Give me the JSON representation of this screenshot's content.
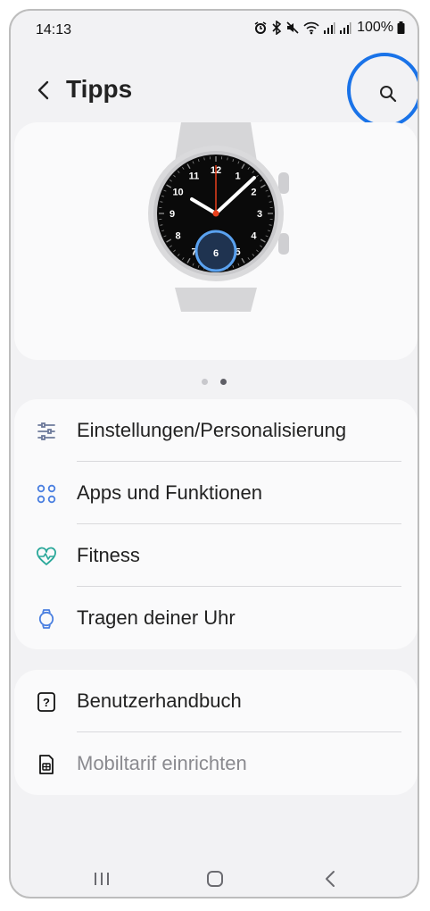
{
  "status_bar": {
    "time": "14:13",
    "battery": "100%",
    "icons": [
      "alarm-icon",
      "bluetooth-icon",
      "mute-icon",
      "wifi-icon",
      "signal-icon",
      "signal-icon",
      "battery-icon"
    ]
  },
  "header": {
    "title": "Tipps",
    "back_icon": "chevron-left-icon",
    "search_icon": "search-icon",
    "highlight_color": "#1a73e8"
  },
  "hero": {
    "image": "galaxy-watch-illustration",
    "watch_numbers": [
      "12",
      "1",
      "2",
      "3",
      "4",
      "5",
      "6",
      "7",
      "8",
      "9",
      "10",
      "11"
    ],
    "highlight_color": "#5aa2f0",
    "second_hand_color": "#e8401c"
  },
  "pager": {
    "count": 2,
    "active": 2
  },
  "menu": {
    "items": [
      {
        "label": "Einstellungen/Personalisierung",
        "icon": "sliders-icon",
        "icon_color": "#6d7a9b"
      },
      {
        "label": "Apps und Funktionen",
        "icon": "apps-grid-icon",
        "icon_color": "#4a7fe0"
      },
      {
        "label": "Fitness",
        "icon": "heart-pulse-icon",
        "icon_color": "#2aa89a"
      },
      {
        "label": "Tragen deiner Uhr",
        "icon": "watch-icon",
        "icon_color": "#4a7fe0"
      }
    ]
  },
  "secondary": {
    "items": [
      {
        "label": "Benutzerhandbuch",
        "icon": "help-book-icon",
        "enabled": true
      },
      {
        "label": "Mobiltarif einrichten",
        "icon": "sim-card-icon",
        "enabled": false
      }
    ]
  },
  "nav_bar": {
    "recents_icon": "recents-icon",
    "home_icon": "home-icon",
    "back_icon": "back-icon"
  }
}
